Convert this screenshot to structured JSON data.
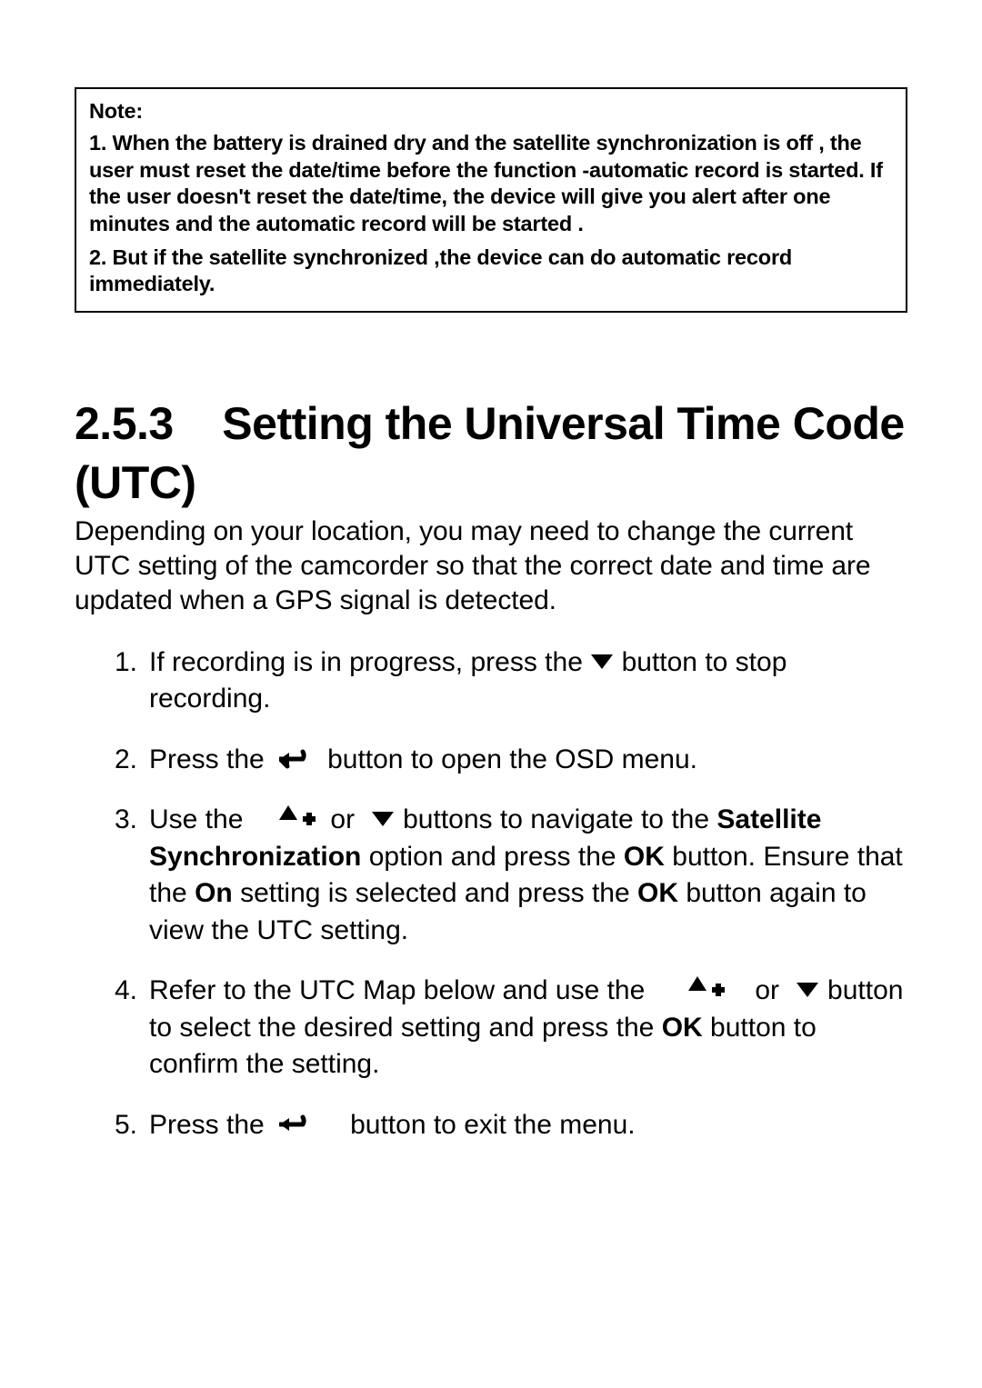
{
  "note": {
    "heading": "Note:",
    "p1": "1. When the battery is drained dry and the satellite synchronization is off , the user must reset the date/time before the function -automatic record is started. If the user doesn't reset the date/time, the device will give you alert after one minutes and the automatic record will be started .",
    "p2": "2. But if the satellite synchronized ,the device can do automatic record immediately."
  },
  "section": {
    "number": "2.5.3",
    "title": "Setting the Universal Time Code (UTC)",
    "intro": "Depending on your location, you may need to change the current UTC setting of the camcorder so that the correct date and time are updated when a GPS signal is detected."
  },
  "steps": {
    "s1": {
      "num": "1.",
      "a": "If recording is in progress, press the",
      "b": "button to stop recording."
    },
    "s2": {
      "num": "2.",
      "a": "Press the",
      "b": "button to open the OSD menu."
    },
    "s3": {
      "num": "3.",
      "a": "Use the",
      "or": "or",
      "b": "buttons to navigate to the",
      "sat": "Satellite Synchronization",
      "c": "option and press the",
      "ok": "OK",
      "d": "button. Ensure that the",
      "on": "On",
      "e": "setting is selected and press the",
      "f": "button again to view the UTC setting."
    },
    "s4": {
      "num": "4.",
      "a": "Refer to the UTC Map below and use the",
      "or": "or",
      "b": "button to select the desired setting and press the",
      "ok": "OK",
      "c": "button to confirm the setting."
    },
    "s5": {
      "num": "5.",
      "a": "Press the",
      "b": "button to exit the menu."
    }
  }
}
